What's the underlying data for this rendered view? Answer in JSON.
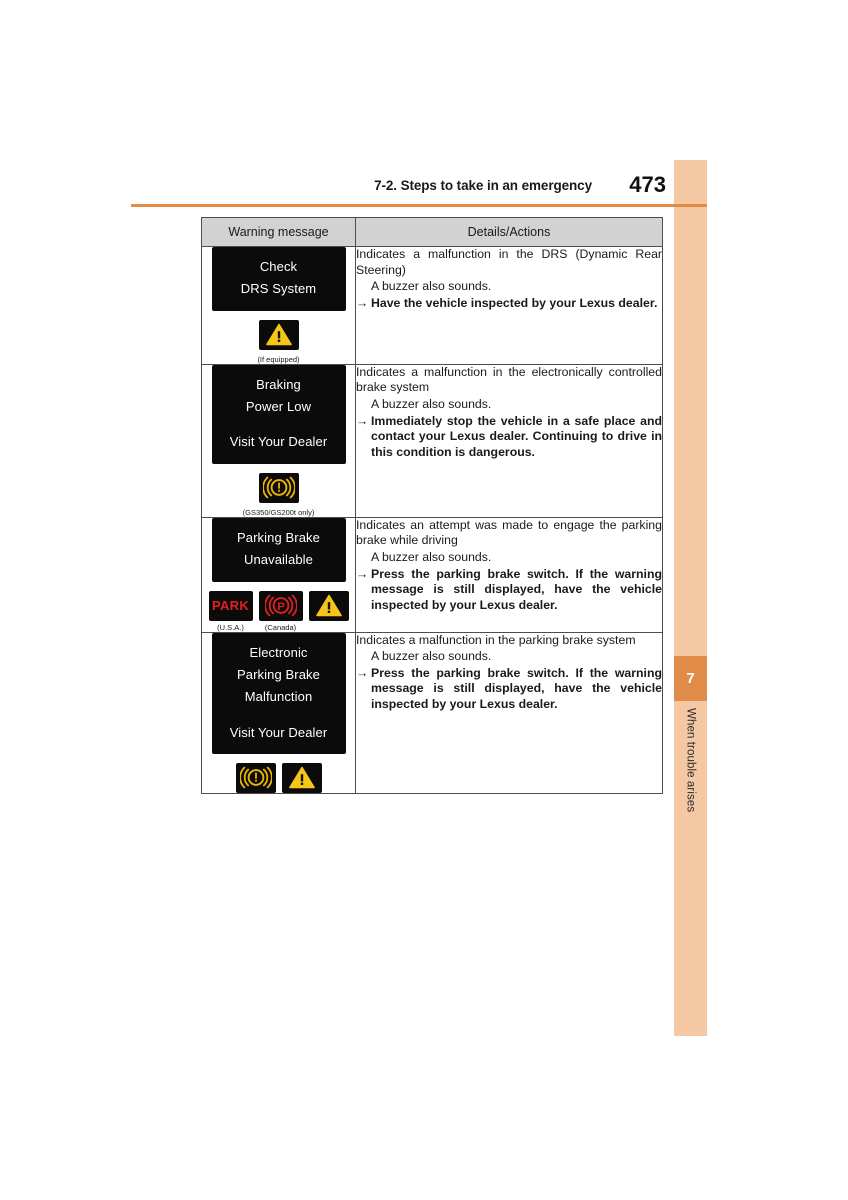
{
  "header": {
    "section_title": "7-2. Steps to take in an emergency",
    "page_number": "473"
  },
  "side_tab": {
    "chapter_number": "7",
    "chapter_label": "When trouble arises",
    "band_color": "#f4c8a2",
    "tab_color": "#e08b47"
  },
  "table": {
    "columns": {
      "warning_message": "Warning message",
      "details_actions": "Details/Actions"
    },
    "rows": [
      {
        "display_lines": [
          "Check",
          "DRS System"
        ],
        "gap_before_last": false,
        "icons": [
          {
            "type": "warning-triangle-icon",
            "caption": ""
          }
        ],
        "sub_caption": "(If equipped)",
        "lead": "Indicates a malfunction in the DRS (Dynamic Rear Steering)",
        "sub": "A buzzer also sounds.",
        "arrow": "→",
        "action": "Have the vehicle inspected by your Lexus dealer."
      },
      {
        "display_lines": [
          "Braking",
          "Power Low",
          "Visit Your Dealer"
        ],
        "gap_before_last": true,
        "icons": [
          {
            "type": "brake-warning-icon",
            "caption": ""
          }
        ],
        "sub_caption": "(GS350/GS200t only)",
        "lead": "Indicates a malfunction in the electronically controlled brake system",
        "sub": "A buzzer also sounds.",
        "arrow": "→",
        "action": "Immediately stop the vehicle in a safe place and contact your Lexus dealer. Continuing to drive in this condition is dangerous."
      },
      {
        "display_lines": [
          "Parking Brake",
          "Unavailable"
        ],
        "gap_before_last": false,
        "icons": [
          {
            "type": "park-indicator-icon",
            "caption": "(U.S.A.)",
            "label": "PARK"
          },
          {
            "type": "parking-brake-p-icon",
            "caption": "(Canada)"
          },
          {
            "type": "warning-triangle-icon",
            "caption": ""
          }
        ],
        "sub_caption": "",
        "lead": "Indicates an attempt was made to engage the parking brake while driving",
        "sub": "A buzzer also sounds.",
        "arrow": "→",
        "action": "Press the parking brake switch. If the warning message is still displayed, have the vehicle inspected by your Lexus dealer."
      },
      {
        "display_lines": [
          "Electronic",
          "Parking Brake",
          "Malfunction",
          "Visit Your Dealer"
        ],
        "gap_before_last": true,
        "icons": [
          {
            "type": "brake-warning-icon",
            "caption": ""
          },
          {
            "type": "warning-triangle-icon",
            "caption": ""
          }
        ],
        "sub_caption": "",
        "lead": "Indicates a malfunction in the parking brake system",
        "sub": "A buzzer also sounds.",
        "arrow": "→",
        "action": "Press the parking brake switch. If the warning message is still displayed, have the vehicle inspected by your Lexus dealer."
      }
    ]
  }
}
